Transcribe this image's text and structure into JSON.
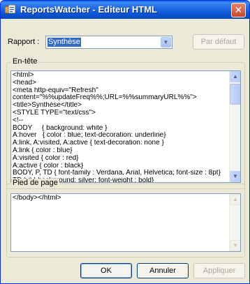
{
  "window": {
    "title": "ReportsWatcher - Editeur HTML",
    "close_glyph": "✕",
    "icon": "reportswatcher-app-icon"
  },
  "rapport": {
    "label": "Rapport :",
    "selected": "Synthèse",
    "dropdown_glyph": "▼",
    "default_button": "Par défaut"
  },
  "entete": {
    "legend": "En-tête",
    "lines": [
      "<html>",
      "<head>",
      "<meta http-equiv=\"Refresh\"",
      "content=\"%%updateFreq%%;URL=%%summaryURL%%\">",
      "<title>Synthèse</title>",
      "<STYLE TYPE=\"text/css\">",
      "<!--",
      "BODY     { background: white }",
      "A:hover   { color : blue; text-decoration: underline}",
      "A:link, A:visited, A:active { text-decoration: none }",
      "A:link { color : blue}",
      "A:visited { color : red}",
      "A:active { color : black}",
      "BODY, P, TD { font-family : Verdana, Arial, Helvetica; font-size : 8pt}",
      "TD.hd { background: silver; font-weight : bold}"
    ]
  },
  "pied": {
    "legend": "Pied de page",
    "lines": [
      "</body></html>"
    ]
  },
  "scroll": {
    "up_glyph": "▲",
    "down_glyph": "▼"
  },
  "buttons": {
    "ok": "OK",
    "annuler": "Annuler",
    "appliquer": "Appliquer"
  }
}
